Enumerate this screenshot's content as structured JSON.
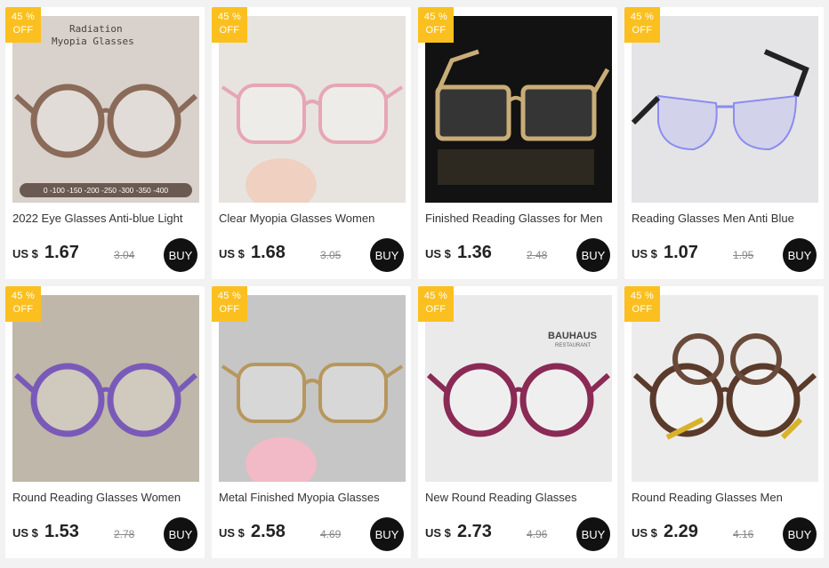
{
  "products": [
    {
      "badge_line1": "45 %",
      "badge_line2": "OFF",
      "image_caption_1": "Radiation",
      "image_caption_2": "Myopia Glasses",
      "image_scale": "0 -100 -150 -200 -250 -300 -350 -400",
      "title": "2022 Eye Glasses Anti-blue Light",
      "currency": "US $",
      "price": "1.67",
      "old_price": "3.04",
      "buy_label": "BUY",
      "bg": "#d9d1cb",
      "frame": "#8a6a58",
      "icon": "round-glasses-icon"
    },
    {
      "badge_line1": "45 %",
      "badge_line2": "OFF",
      "title": "Clear Myopia Glasses Women",
      "currency": "US $",
      "price": "1.68",
      "old_price": "3.05",
      "buy_label": "BUY",
      "bg": "#e7e4e0",
      "frame": "#e7a6b4",
      "icon": "square-glasses-icon"
    },
    {
      "badge_line1": "45 %",
      "badge_line2": "OFF",
      "title": "Finished Reading Glasses for Men",
      "currency": "US $",
      "price": "1.36",
      "old_price": "2.48",
      "buy_label": "BUY",
      "bg": "#121212",
      "frame": "#c9ad78",
      "icon": "rectangle-glasses-icon"
    },
    {
      "badge_line1": "45 %",
      "badge_line2": "OFF",
      "title": "Reading Glasses Men Anti Blue",
      "currency": "US $",
      "price": "1.07",
      "old_price": "1.95",
      "buy_label": "BUY",
      "bg": "#e4e4e6",
      "frame": "#222222",
      "icon": "rimless-glasses-icon"
    },
    {
      "badge_line1": "45 %",
      "badge_line2": "OFF",
      "title": "Round Reading Glasses Women",
      "currency": "US $",
      "price": "1.53",
      "old_price": "2.78",
      "buy_label": "BUY",
      "bg": "#bfb7a9",
      "frame": "#7a5ab8",
      "icon": "round-glasses-icon"
    },
    {
      "badge_line1": "45 %",
      "badge_line2": "OFF",
      "title": "Metal Finished Myopia Glasses",
      "currency": "US $",
      "price": "2.58",
      "old_price": "4.69",
      "buy_label": "BUY",
      "bg": "#c7c6c6",
      "frame": "#b7975d",
      "icon": "metal-glasses-icon"
    },
    {
      "badge_line1": "45 %",
      "badge_line2": "OFF",
      "image_caption_1": "BAUHAUS",
      "image_caption_2": "RESTAURANT",
      "title": "New Round Reading Glasses",
      "currency": "US $",
      "price": "2.73",
      "old_price": "4.96",
      "buy_label": "BUY",
      "bg": "#ebeaea",
      "frame": "#8a2a55",
      "icon": "round-glasses-icon"
    },
    {
      "badge_line1": "45 %",
      "badge_line2": "OFF",
      "title": "Round Reading Glasses Men",
      "currency": "US $",
      "price": "2.29",
      "old_price": "4.16",
      "buy_label": "BUY",
      "bg": "#ececec",
      "frame": "#5a3a2a",
      "icon": "tortoise-glasses-icon"
    }
  ],
  "colors": {
    "badge": "#fbc020",
    "buy_button": "#111111",
    "page_bg": "#f2f2f2"
  }
}
